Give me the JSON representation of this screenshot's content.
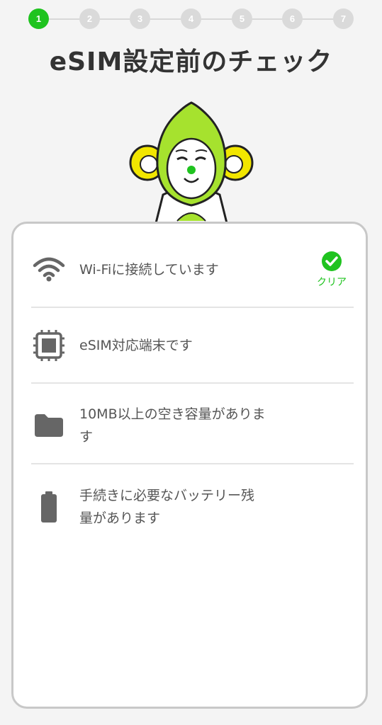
{
  "stepper": {
    "steps": [
      "1",
      "2",
      "3",
      "4",
      "5",
      "6",
      "7"
    ],
    "current": 1
  },
  "page_title": "eSIM設定前のチェック",
  "colors": {
    "accent": "#1fc31f",
    "inactive_step": "#dadada",
    "mascot_green": "#a6e22e",
    "mascot_yellow": "#f2e600"
  },
  "checklist": [
    {
      "icon": "wifi-icon",
      "label": "Wi-Fiに接続しています",
      "status_label": "クリア"
    },
    {
      "icon": "chip-icon",
      "label": "eSIM対応端末です",
      "status_label": ""
    },
    {
      "icon": "folder-icon",
      "label": "10MB以上の空き容量がありま\nす",
      "status_label": ""
    },
    {
      "icon": "battery-icon",
      "label": "手続きに必要なバッテリー残\n量があります",
      "status_label": ""
    }
  ]
}
